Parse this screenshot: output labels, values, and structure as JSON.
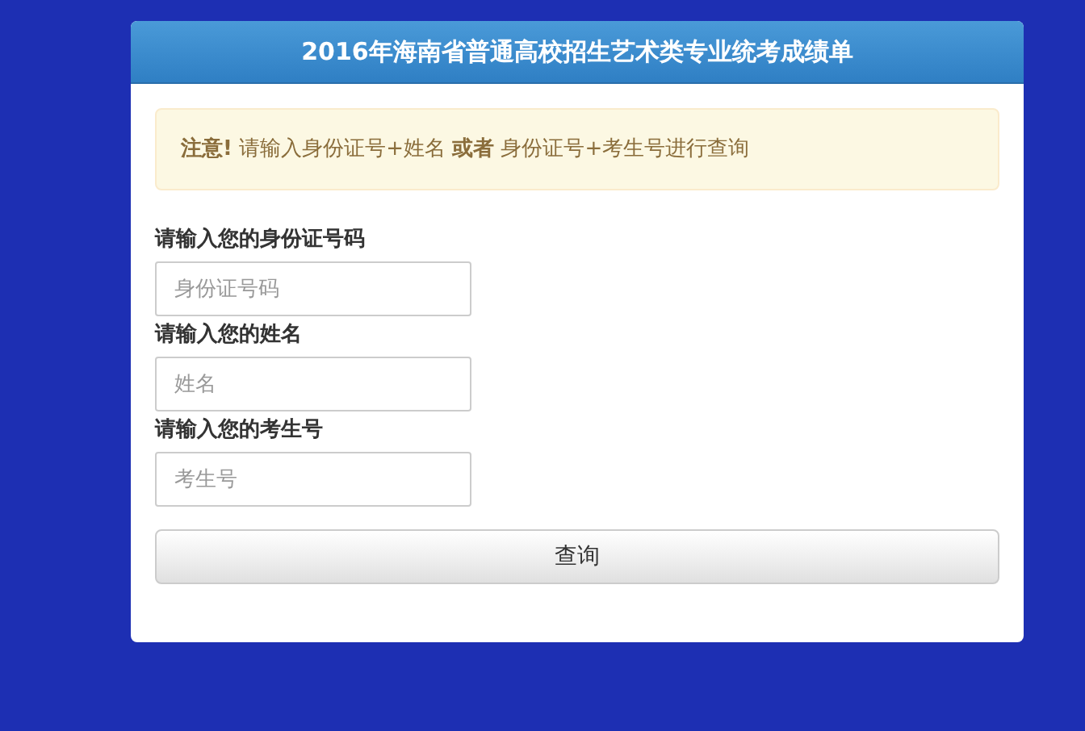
{
  "panel": {
    "title": "2016年海南省普通高校招生艺术类专业统考成绩单"
  },
  "notice": "**注意!** 请输入身份证号+姓名 **或者** 身份证号+考生号进行查询",
  "fields": [
    {
      "label": "请输入您的身份证号码",
      "placeholder": "身份证号码"
    },
    {
      "label": "请输入您的姓名",
      "placeholder": "姓名"
    },
    {
      "label": "请输入您的考生号",
      "placeholder": "考生号"
    }
  ],
  "buttons": [
    "查询"
  ]
}
